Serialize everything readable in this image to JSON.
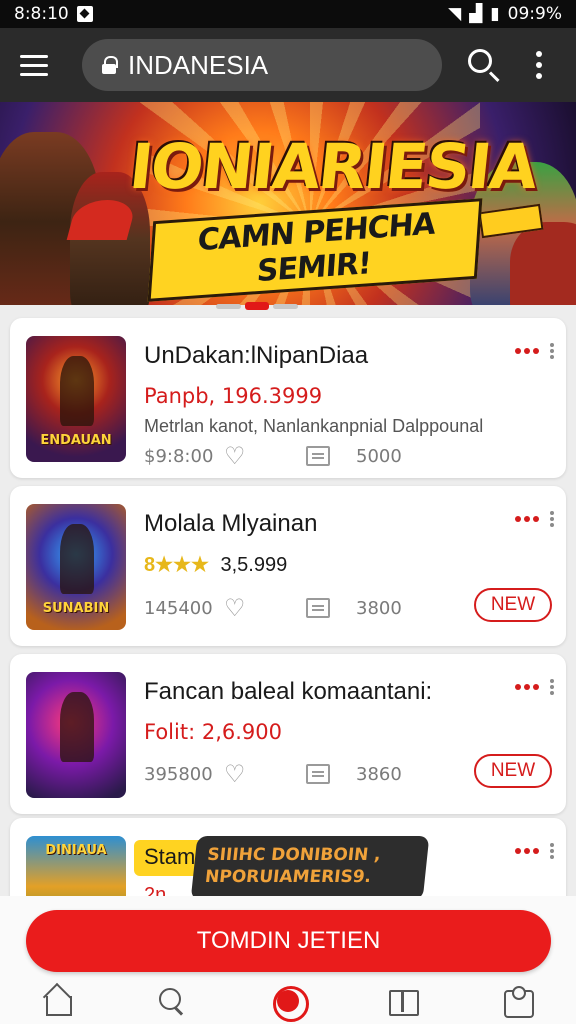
{
  "status_bar": {
    "time": "8:8:10",
    "battery": "09:9%"
  },
  "header": {
    "search_value": "INDANESIA"
  },
  "banner": {
    "title": "IONIARIESIA",
    "subtitle": "CAMN PEHCHA SEMIR!"
  },
  "games": [
    {
      "title": "UnDakan:lNipanDiaa",
      "price": "Panpb, 196.3999",
      "description": "Metrlan kanot, Nanlankanpnial Dalppounal",
      "meta": "$9:8:00",
      "count": "5000",
      "thumb_caption": "ENDAUAN"
    },
    {
      "title": "Molala Mlyainan",
      "rating_stars": "8★★★",
      "rating_value": "3,5.999",
      "meta": "145400",
      "count": "3800",
      "badge": "NEW",
      "thumb_caption": "SUNABIN"
    },
    {
      "title": "Fancan baleal komaantani:",
      "price": "Folit: 2,6.900",
      "meta": "395800",
      "count": "3860",
      "badge": "NEW"
    },
    {
      "title": "Stam",
      "subtitle": "2n",
      "tooltip": "SIIIHC DONIBOIN , NPORUIAMERIS9.",
      "thumb_caption": "DINIAUA"
    }
  ],
  "cta": {
    "label": "TOMDIN JETIEN"
  },
  "colors": {
    "accent": "#e11818",
    "header_bg": "#2b2b2b",
    "card_bg": "#ffffff"
  },
  "icons": [
    "home-icon",
    "search-icon",
    "record-icon",
    "book-icon",
    "puzzle-icon"
  ]
}
